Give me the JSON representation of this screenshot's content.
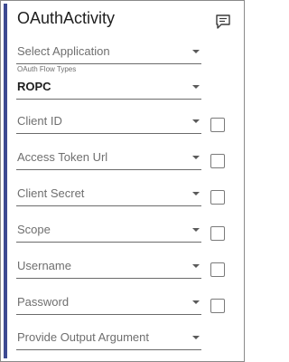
{
  "activity": {
    "title": "OAuthActivity",
    "icon": "comment-icon"
  },
  "select_application": {
    "placeholder": "Select Application"
  },
  "oauth_flow_types": {
    "label": "OAuth Flow Types",
    "value": "ROPC"
  },
  "fields": {
    "client_id": {
      "placeholder": "Client ID"
    },
    "access_token_url": {
      "placeholder": "Access Token Url"
    },
    "client_secret": {
      "placeholder": "Client Secret"
    },
    "scope": {
      "placeholder": "Scope"
    },
    "username": {
      "placeholder": "Username"
    },
    "password": {
      "placeholder": "Password"
    }
  },
  "output_argument": {
    "placeholder": "Provide Output Argument"
  },
  "colors": {
    "accent": "#3d4a91",
    "border": "#8a8a8a",
    "placeholder_text": "#6f6f6f"
  }
}
